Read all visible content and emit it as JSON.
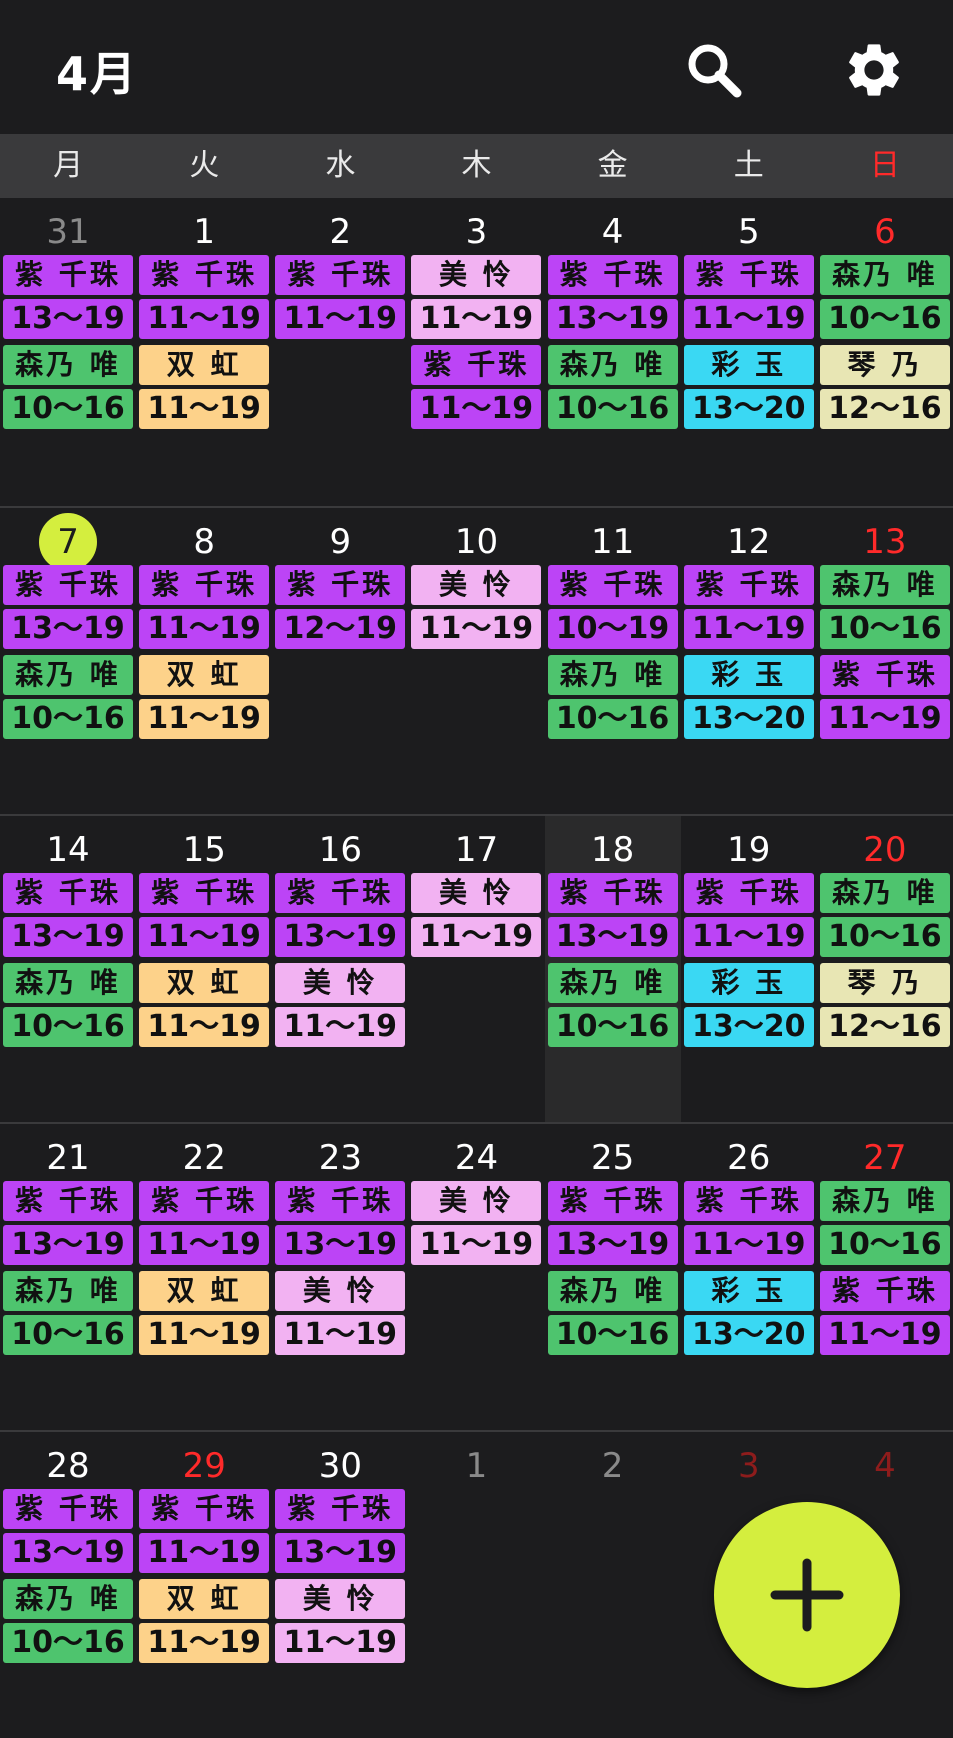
{
  "header": {
    "title": "4月"
  },
  "weekdays": [
    "月",
    "火",
    "水",
    "木",
    "金",
    "土",
    "日"
  ],
  "colors": {
    "purple": "#bc44f6",
    "lightpink": "#f2b2f2",
    "green": "#4ec46e",
    "orange": "#fdd28a",
    "cyan": "#3ad8f3",
    "beige": "#e8e6b4",
    "today": "#d4ee3e",
    "red": "#ff2a2a",
    "darkred": "#8e1c1c",
    "gray": "#8a8a8a"
  },
  "weeks": [
    {
      "days": [
        {
          "num": "31",
          "style": "gray",
          "events": [
            {
              "name": "紫 千珠",
              "time": "13〜19",
              "color": "purple"
            },
            {
              "name": "森乃 唯",
              "time": "10〜16",
              "color": "green"
            }
          ]
        },
        {
          "num": "1",
          "events": [
            {
              "name": "紫 千珠",
              "time": "11〜19",
              "color": "purple"
            },
            {
              "name": "双 虹",
              "time": "11〜19",
              "color": "orange"
            }
          ]
        },
        {
          "num": "2",
          "events": [
            {
              "name": "紫 千珠",
              "time": "11〜19",
              "color": "purple"
            }
          ]
        },
        {
          "num": "3",
          "events": [
            {
              "name": "美 怜",
              "time": "11〜19",
              "color": "lightpink"
            },
            {
              "name": "紫 千珠",
              "time": "11〜19",
              "color": "purple"
            }
          ]
        },
        {
          "num": "4",
          "events": [
            {
              "name": "紫 千珠",
              "time": "13〜19",
              "color": "purple"
            },
            {
              "name": "森乃 唯",
              "time": "10〜16",
              "color": "green"
            }
          ]
        },
        {
          "num": "5",
          "events": [
            {
              "name": "紫 千珠",
              "time": "11〜19",
              "color": "purple"
            },
            {
              "name": "彩 玉",
              "time": "13〜20",
              "color": "cyan"
            }
          ]
        },
        {
          "num": "6",
          "style": "red",
          "events": [
            {
              "name": "森乃 唯",
              "time": "10〜16",
              "color": "green"
            },
            {
              "name": "琴 乃",
              "time": "12〜16",
              "color": "beige"
            }
          ]
        }
      ]
    },
    {
      "days": [
        {
          "num": "7",
          "style": "today",
          "events": [
            {
              "name": "紫 千珠",
              "time": "13〜19",
              "color": "purple"
            },
            {
              "name": "森乃 唯",
              "time": "10〜16",
              "color": "green"
            }
          ]
        },
        {
          "num": "8",
          "events": [
            {
              "name": "紫 千珠",
              "time": "11〜19",
              "color": "purple"
            },
            {
              "name": "双 虹",
              "time": "11〜19",
              "color": "orange"
            }
          ]
        },
        {
          "num": "9",
          "events": [
            {
              "name": "紫 千珠",
              "time": "12〜19",
              "color": "purple"
            }
          ]
        },
        {
          "num": "10",
          "events": [
            {
              "name": "美 怜",
              "time": "11〜19",
              "color": "lightpink"
            }
          ]
        },
        {
          "num": "11",
          "events": [
            {
              "name": "紫 千珠",
              "time": "10〜19",
              "color": "purple"
            },
            {
              "name": "森乃 唯",
              "time": "10〜16",
              "color": "green"
            }
          ]
        },
        {
          "num": "12",
          "events": [
            {
              "name": "紫 千珠",
              "time": "11〜19",
              "color": "purple"
            },
            {
              "name": "彩 玉",
              "time": "13〜20",
              "color": "cyan"
            }
          ]
        },
        {
          "num": "13",
          "style": "red",
          "events": [
            {
              "name": "森乃 唯",
              "time": "10〜16",
              "color": "green"
            },
            {
              "name": "紫 千珠",
              "time": "11〜19",
              "color": "purple"
            }
          ]
        }
      ]
    },
    {
      "days": [
        {
          "num": "14",
          "events": [
            {
              "name": "紫 千珠",
              "time": "13〜19",
              "color": "purple"
            },
            {
              "name": "森乃 唯",
              "time": "10〜16",
              "color": "green"
            }
          ]
        },
        {
          "num": "15",
          "events": [
            {
              "name": "紫 千珠",
              "time": "11〜19",
              "color": "purple"
            },
            {
              "name": "双 虹",
              "time": "11〜19",
              "color": "orange"
            }
          ]
        },
        {
          "num": "16",
          "events": [
            {
              "name": "紫 千珠",
              "time": "13〜19",
              "color": "purple"
            },
            {
              "name": "美 怜",
              "time": "11〜19",
              "color": "lightpink"
            }
          ]
        },
        {
          "num": "17",
          "events": [
            {
              "name": "美 怜",
              "time": "11〜19",
              "color": "lightpink"
            }
          ]
        },
        {
          "num": "18",
          "highlight": true,
          "events": [
            {
              "name": "紫 千珠",
              "time": "13〜19",
              "color": "purple"
            },
            {
              "name": "森乃 唯",
              "time": "10〜16",
              "color": "green"
            }
          ]
        },
        {
          "num": "19",
          "events": [
            {
              "name": "紫 千珠",
              "time": "11〜19",
              "color": "purple"
            },
            {
              "name": "彩 玉",
              "time": "13〜20",
              "color": "cyan"
            }
          ]
        },
        {
          "num": "20",
          "style": "red",
          "events": [
            {
              "name": "森乃 唯",
              "time": "10〜16",
              "color": "green"
            },
            {
              "name": "琴 乃",
              "time": "12〜16",
              "color": "beige"
            }
          ]
        }
      ]
    },
    {
      "days": [
        {
          "num": "21",
          "events": [
            {
              "name": "紫 千珠",
              "time": "13〜19",
              "color": "purple"
            },
            {
              "name": "森乃 唯",
              "time": "10〜16",
              "color": "green"
            }
          ]
        },
        {
          "num": "22",
          "events": [
            {
              "name": "紫 千珠",
              "time": "11〜19",
              "color": "purple"
            },
            {
              "name": "双 虹",
              "time": "11〜19",
              "color": "orange"
            }
          ]
        },
        {
          "num": "23",
          "events": [
            {
              "name": "紫 千珠",
              "time": "13〜19",
              "color": "purple"
            },
            {
              "name": "美 怜",
              "time": "11〜19",
              "color": "lightpink"
            }
          ]
        },
        {
          "num": "24",
          "events": [
            {
              "name": "美 怜",
              "time": "11〜19",
              "color": "lightpink"
            }
          ]
        },
        {
          "num": "25",
          "events": [
            {
              "name": "紫 千珠",
              "time": "13〜19",
              "color": "purple"
            },
            {
              "name": "森乃 唯",
              "time": "10〜16",
              "color": "green"
            }
          ]
        },
        {
          "num": "26",
          "events": [
            {
              "name": "紫 千珠",
              "time": "11〜19",
              "color": "purple"
            },
            {
              "name": "彩 玉",
              "time": "13〜20",
              "color": "cyan"
            }
          ]
        },
        {
          "num": "27",
          "style": "red",
          "events": [
            {
              "name": "森乃 唯",
              "time": "10〜16",
              "color": "green"
            },
            {
              "name": "紫 千珠",
              "time": "11〜19",
              "color": "purple"
            }
          ]
        }
      ]
    },
    {
      "days": [
        {
          "num": "28",
          "events": [
            {
              "name": "紫 千珠",
              "time": "13〜19",
              "color": "purple"
            },
            {
              "name": "森乃 唯",
              "time": "10〜16",
              "color": "green"
            }
          ]
        },
        {
          "num": "29",
          "style": "red",
          "events": [
            {
              "name": "紫 千珠",
              "time": "11〜19",
              "color": "purple"
            },
            {
              "name": "双 虹",
              "time": "11〜19",
              "color": "orange"
            }
          ]
        },
        {
          "num": "30",
          "events": [
            {
              "name": "紫 千珠",
              "time": "13〜19",
              "color": "purple"
            },
            {
              "name": "美 怜",
              "time": "11〜19",
              "color": "lightpink"
            }
          ]
        },
        {
          "num": "1",
          "style": "gray",
          "events": []
        },
        {
          "num": "2",
          "style": "gray",
          "events": []
        },
        {
          "num": "3",
          "style": "darkred",
          "events": []
        },
        {
          "num": "4",
          "style": "darkred",
          "events": []
        }
      ]
    }
  ],
  "icons": {
    "search": "search-icon",
    "settings": "gear-icon",
    "add": "plus-icon"
  }
}
